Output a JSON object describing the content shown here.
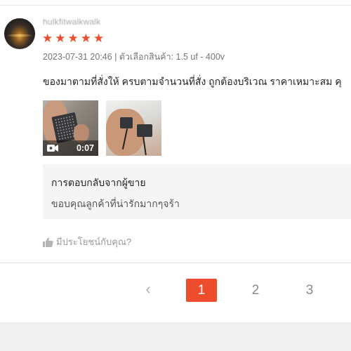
{
  "review": {
    "username": "hulkfitwalkwalk",
    "rating": 5,
    "date": "2023-07-31 20:46",
    "variant": "| ตัวเลือกสินค้า: 1.5 uf - 400v",
    "text": "ของมาตามที่สั่งให้ ครบตามจำนวนที่สั่ง ถูกต้องบริเวณ ราคาเหมาะสม คุ",
    "media": {
      "video_duration": "0:07"
    },
    "seller_reply": {
      "title": "การตอบกลับจากผู้ขาย",
      "text": "ขอบคุณลูกค้าที่น่ารักมากๆจร้า"
    },
    "helpful_label": "มีประโยชน์กับคุณ?"
  },
  "pagination": {
    "prev_symbol": "‹",
    "pages": [
      "1",
      "2",
      "3"
    ],
    "active_page": "1"
  },
  "colors": {
    "accent": "#ee4d2d",
    "reply_bg": "#f5f5f5"
  }
}
